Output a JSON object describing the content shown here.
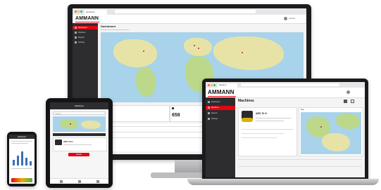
{
  "brand": {
    "logo": "AMMANN",
    "accent": "#e30613"
  },
  "monitor": {
    "tab_label": "Dashboard",
    "page_title": "Dashboard",
    "sidebar_items": [
      "Dashboard",
      "Machines",
      "Reports",
      "Settings"
    ],
    "stat_value": "658",
    "account_label": "Account"
  },
  "laptop": {
    "tab_label": "Machines",
    "page_title": "Machines",
    "sidebar_items": [
      "Dashboard",
      "Machines",
      "Reports",
      "Settings"
    ],
    "machine_title": "ARS 70 H",
    "map_label": "Map"
  },
  "tablet": {
    "title": "Machines",
    "search_placeholder": "Search",
    "machine_title": "ARS 70 H",
    "button_label": "Details"
  },
  "phone": {
    "title": "Dashboard"
  },
  "icons": [
    "window-dot-icon",
    "user-avatar-icon",
    "grid-icon",
    "bell-icon",
    "roller-machine-icon",
    "chart-bars-icon"
  ]
}
